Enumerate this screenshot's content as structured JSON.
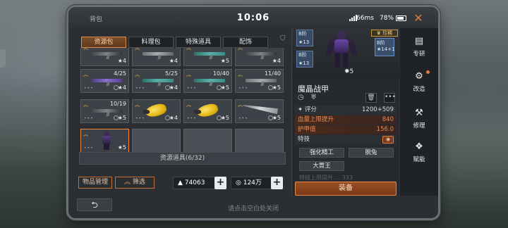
{
  "status": {
    "title": "背包",
    "time": "10:06",
    "ping": "66ms",
    "battery": "78%"
  },
  "tabs": [
    "资源包",
    "料理包",
    "特殊道具",
    "配饰"
  ],
  "grid": {
    "rows": [
      [
        {
          "qty": "4"
        },
        {
          "qty": "4"
        },
        {
          "qty": "5"
        },
        {
          "qty": "4"
        }
      ],
      [
        {
          "qty": "4/25"
        },
        {
          "qty": "5/25"
        },
        {
          "qty": "10/40"
        },
        {
          "qty": "11/40"
        }
      ],
      [
        {
          "qty": "10/19"
        },
        {
          "qty": ""
        },
        {
          "qty": ""
        },
        {
          "qty": ""
        }
      ],
      [
        {
          "qty": ""
        }
      ]
    ],
    "star_labels": [
      "4",
      "4",
      "5",
      "5",
      "5",
      "4",
      "5",
      "5",
      "5",
      "5"
    ]
  },
  "resource_bar": "资源道具(6/32)",
  "buttons": {
    "manage": "物品管理",
    "filter": "筛选",
    "equip": "装备"
  },
  "currency": {
    "coins": "74063",
    "gems": "124万"
  },
  "hint": "请点击空白处关闭",
  "detail": {
    "badges": [
      {
        "grade": "B阶",
        "stars": "13"
      },
      {
        "grade": "B阶",
        "stars": "13"
      }
    ],
    "star_count": "5",
    "rare_label": "珍稀",
    "rare_badge": {
      "grade": "B阶",
      "stars": "14+1"
    },
    "item_name": "魔晶战甲",
    "score_label": "评分",
    "score_value": "1200+509",
    "stats": [
      {
        "label": "血量上限提升",
        "value": "840"
      },
      {
        "label": "护甲值",
        "value": "156.0"
      }
    ],
    "skill_title": "特技",
    "skills": [
      "强化精工",
      "脱兔",
      "大胃王"
    ],
    "faded_row": "特技上限提升 ... 333"
  },
  "sidenav": [
    "专研",
    "改造",
    "修理",
    "赋能"
  ]
}
